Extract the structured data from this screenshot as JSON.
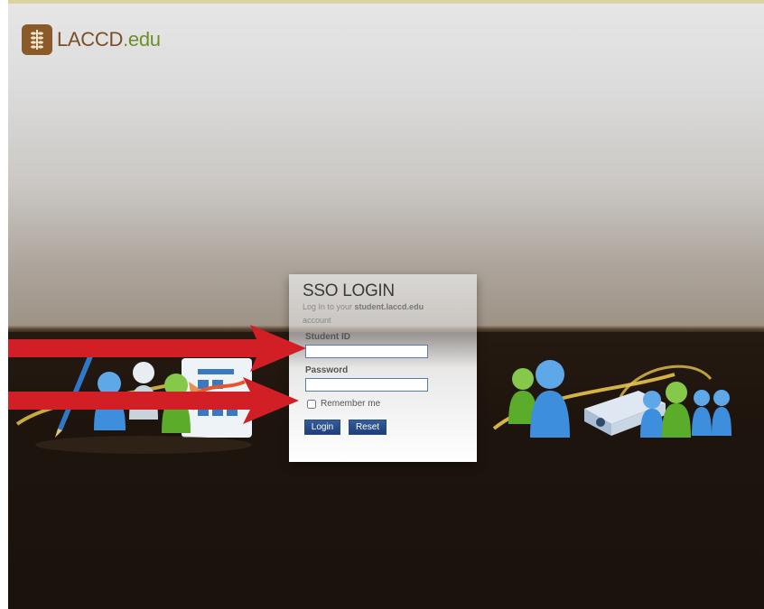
{
  "brand": {
    "logo_main": "LACCD",
    "logo_tld": ".edu",
    "logo_icon": "wheat-shield-icon"
  },
  "login": {
    "title": "SSO LOGIN",
    "subtitle_prefix": "Log In to your ",
    "subtitle_domain": "student.laccd.edu",
    "subtitle_suffix": "account",
    "student_id_label": "Student ID",
    "student_id_value": "",
    "password_label": "Password",
    "password_value": "",
    "remember_label": "Remember me",
    "remember_checked": false,
    "login_button": "Login",
    "reset_button": "Reset"
  },
  "annotations": [
    {
      "name": "arrow-to-student-id",
      "color": "#d21f26"
    },
    {
      "name": "arrow-to-password",
      "color": "#d21f26"
    }
  ],
  "colors": {
    "accent": "#1f4380",
    "brand_brown": "#7b4f26",
    "brand_green": "#6d8f2a",
    "arrow_red": "#d21f26"
  }
}
